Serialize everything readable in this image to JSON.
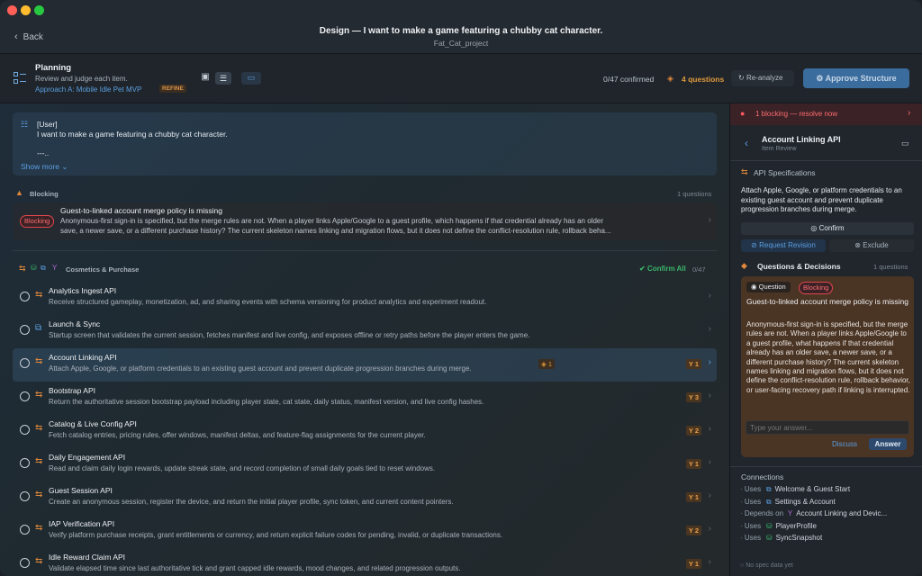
{
  "window": {
    "title": "Design — I want to make a game featuring a chubby cat character.",
    "subtitle": "Fat_Cat_project",
    "back_label": "Back"
  },
  "toolbar": {
    "title": "Planning",
    "subtitle": "Review and judge each item.",
    "approach": "Approach A: Mobile Idle Pet MVP",
    "approach_tag": "REFINE",
    "confirmed": "0/47 confirmed",
    "questions": "4 questions",
    "reanalyze": "Re-analyze",
    "approve": "Approve Structure"
  },
  "prompt": {
    "tag": "[User]",
    "text": "I want to make a game featuring a chubby cat character.",
    "more": "---..",
    "show_more": "Show more"
  },
  "blocking": {
    "heading": "Blocking",
    "count": "1 questions",
    "pill": "Blocking",
    "title": "Guest-to-linked account merge policy is missing",
    "line1": "Anonymous-first sign-in is specified, but the merge rules are not. When a player links Apple/Google to a guest profile, which happens if that credential already has an older",
    "line2": "save, a newer save, or a different purchase history? The current skeleton names linking and migration flows, but it does not define the conflict-resolution rule, rollback beha..."
  },
  "group": {
    "title": "Cosmetics & Purchase",
    "confirm_all": "Confirm All",
    "count": "0/47"
  },
  "items": [
    {
      "title": "Analytics Ingest API",
      "desc": "Receive structured gameplay, monetization, ad, and sharing events with schema versioning for product analytics and experiment readout.",
      "badge": "",
      "icon": "swap-icon"
    },
    {
      "title": "Launch & Sync",
      "desc": "Startup screen that validates the current session, fetches manifest and live config, and exposes offline or retry paths before the player enters the game.",
      "badge": "",
      "icon": "screen-icon"
    },
    {
      "title": "Account Linking API",
      "desc": "Attach Apple, Google, or platform credentials to an existing guest account and prevent duplicate progression branches during merge.",
      "badge": "1",
      "question_badge": "1",
      "icon": "swap-icon"
    },
    {
      "title": "Bootstrap API",
      "desc": "Return the authoritative session bootstrap payload including player state, cat state, daily status, manifest version, and live config hashes.",
      "badge": "3",
      "icon": "swap-icon"
    },
    {
      "title": "Catalog & Live Config API",
      "desc": "Fetch catalog entries, pricing rules, offer windows, manifest deltas, and feature-flag assignments for the current player.",
      "badge": "2",
      "icon": "swap-icon"
    },
    {
      "title": "Daily Engagement API",
      "desc": "Read and claim daily login rewards, update streak state, and record completion of small daily goals tied to reset windows.",
      "badge": "1",
      "icon": "swap-icon"
    },
    {
      "title": "Guest Session API",
      "desc": "Create an anonymous session, register the device, and return the initial player profile, sync token, and current content pointers.",
      "badge": "1",
      "icon": "swap-icon"
    },
    {
      "title": "IAP Verification API",
      "desc": "Verify platform purchase receipts, grant entitlements or currency, and return explicit failure codes for pending, invalid, or duplicate transactions.",
      "badge": "2",
      "icon": "swap-icon"
    },
    {
      "title": "Idle Reward Claim API",
      "desc": "Validate elapsed time since last authoritative tick and grant capped idle rewards, mood changes, and related progression outputs.",
      "badge": "1",
      "icon": "swap-icon"
    }
  ],
  "side": {
    "banner": "1 blocking — resolve now",
    "title": "Account Linking API",
    "subtitle": "Item Review",
    "spec_heading": "API Specifications",
    "spec_text": "Attach Apple, Google, or platform credentials to an existing guest account and prevent duplicate progression branches during merge.",
    "confirm": "Confirm",
    "request_revision": "Request Revision",
    "exclude": "Exclude",
    "qd_heading": "Questions & Decisions",
    "qd_count": "1 questions",
    "q_label": "Question",
    "q_pill": "Blocking",
    "q_title": "Guest-to-linked account merge policy is missing",
    "q_body": "Anonymous-first sign-in is specified, but the merge rules are not. When a player links Apple/Google to a guest profile, what happens if that credential already has an older save, a newer save, or a different purchase history? The current skeleton names linking and migration flows, but it does not define the conflict-resolution rule, rollback behavior, or user-facing recovery path if linking is interrupted.",
    "answer_placeholder": "Type your answer...",
    "discuss": "Discuss",
    "answer": "Answer",
    "connections_heading": "Connections",
    "connections": [
      {
        "kind": "Uses",
        "name": "Welcome & Guest Start",
        "icon": "screen-icon"
      },
      {
        "kind": "Uses",
        "name": "Settings & Account",
        "icon": "screen-icon"
      },
      {
        "kind": "Depends on",
        "name": "Account Linking and Devic...",
        "icon": "fork-icon"
      },
      {
        "kind": "Uses",
        "name": "PlayerProfile",
        "icon": "db-icon"
      },
      {
        "kind": "Uses",
        "name": "SyncSnapshot",
        "icon": "db-icon"
      }
    ],
    "no_spec": "No spec data yet"
  },
  "colors": {
    "accent": "#2f6fb0",
    "blocking": "#e0474c",
    "warning": "#e0883a",
    "success": "#39b56a"
  }
}
